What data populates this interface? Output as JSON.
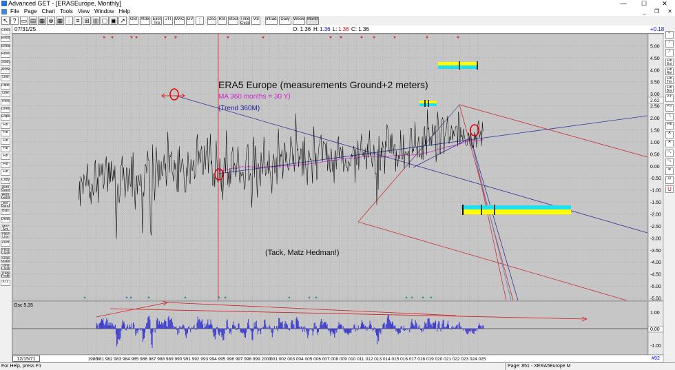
{
  "window": {
    "title": "Advanced GET - [ERASEurope, Monthly]",
    "min": "—",
    "max": "☐",
    "close": "✕"
  },
  "menu": {
    "items": [
      "File",
      "Page",
      "Chart",
      "Tools",
      "View",
      "Window",
      "Help"
    ],
    "mdi": [
      "_",
      "❐",
      "✕"
    ]
  },
  "toolbar": {
    "buttons": [
      "OSI",
      "Xtdes",
      "Eliot Trg",
      "JTI",
      "MACD",
      "GV",
      "Osc",
      "RSI",
      "Stoch",
      "Time Cycle",
      "Vol"
    ],
    "periods": [
      "Intraday",
      "Daily",
      "Weekly",
      "Monthly"
    ],
    "selected_period": "Monthly"
  },
  "header": {
    "date": "07/31/25",
    "o": "O: 1.36",
    "h_label": "H:",
    "h_value": "1.36",
    "l_label": "L:",
    "l_value": "1.36",
    "c": "C: 1.36",
    "change": "+0.18"
  },
  "left_tools": [
    "Cross",
    "Elliott",
    "Elliott",
    "Reset",
    "Study",
    "Arrow",
    "Line",
    "Pattern",
    "Line",
    "Trend",
    "Lines",
    "Ellipse",
    "Fib",
    "Fib",
    "Fib",
    "Fib",
    "Fib",
    "Fib",
    "Fib",
    "Copy",
    "Auto Gann",
    "Auto Gann",
    "Bol Band",
    "Bias",
    "Delta",
    "Mov Ave",
    "Pitch Line",
    "Pivot",
    "Price Cluster",
    "Seas onals",
    "Time Cluster",
    "Trade Profile",
    "XTL"
  ],
  "right_tools": [
    "↖",
    "⌇",
    "╱",
    "Fib Ext",
    "Fib Ret",
    "Fib Tim",
    "Fib Box",
    "XY",
    "PTI",
    "╲",
    "Fib",
    "A",
    "A",
    "🔍",
    "🔍",
    "⊕",
    "⊟",
    "U"
  ],
  "chart_data": [
    {
      "type": "line",
      "title": "ERA5 Europe (measurements Ground+2 meters)",
      "annotations": [
        "MA 360 months = 30 Y)",
        "(Trend 360M)",
        "(Tack, Matz Hedman!)"
      ],
      "price_label": "2.62",
      "ylim": [
        -5.6,
        5.5
      ],
      "y_ticks": [
        5.0,
        4.5,
        4.0,
        3.5,
        3.0,
        2.5,
        2.0,
        1.5,
        1.0,
        0.5,
        0.0,
        -0.5,
        -1.0,
        -1.5,
        -2.0,
        -2.5,
        -3.0,
        -3.5,
        -4.0,
        -4.5,
        -5.0,
        -5.5
      ],
      "x_labels": [
        "1980",
        "981",
        "982",
        "983",
        "984",
        "985",
        "986",
        "987",
        "988",
        "989",
        "990",
        "991",
        "992",
        "993",
        "994",
        "995",
        "996",
        "997",
        "998",
        "999",
        "2000",
        "001",
        "002",
        "003",
        "004",
        "005",
        "006",
        "007",
        "008",
        "009",
        "010",
        "011",
        "012",
        "013",
        "014",
        "015",
        "016",
        "017",
        "018",
        "019",
        "020",
        "021",
        "022",
        "023",
        "024",
        "025"
      ],
      "series": [
        {
          "x_start": 1979.0,
          "monthly_profile": [
            -1.4,
            -0.7,
            -1.2,
            0.0,
            -0.6,
            -0.8,
            -0.6,
            -0.9,
            -0.6,
            -0.5,
            -0.6,
            -0.7,
            0.2,
            -0.6,
            -0.5,
            -1.4,
            -1.2,
            -1.1,
            -0.5,
            -1.2,
            -0.3,
            -0.6,
            -0.3,
            -0.5,
            -0.9,
            -0.9,
            -1.6,
            0.4,
            -0.5,
            -0.6,
            0.4,
            0.1,
            -0.5,
            -0.9,
            -0.4,
            -0.3,
            0.3,
            0.9,
            -0.8,
            -0.9,
            0.6,
            -0.4,
            -0.4,
            -0.3,
            -0.3,
            -0.3,
            -0.3,
            -0.3,
            -0.5,
            -0.2,
            -3.8,
            -1.4,
            -0.4,
            -1.0,
            -0.6,
            -1.5,
            -0.3,
            -0.2,
            0.0,
            -0.6,
            0.2,
            -0.6,
            -1.2,
            -1.5,
            0.0,
            0.0,
            -0.8,
            -0.1,
            -0.4,
            -0.3,
            -0.6,
            0.1,
            -2.0,
            0.3,
            -1.4,
            -1.6,
            -2.3,
            -0.4,
            -0.5,
            -0.6,
            0.1,
            -0.6,
            -0.3,
            -1.0,
            -0.2,
            -2.6,
            -2.4,
            -0.8,
            -0.4,
            0.0,
            -0.1,
            0.4,
            -0.2,
            0.5,
            -0.3,
            0.0,
            -2.6,
            -2.3,
            -3.1,
            0.4,
            0.1,
            -0.2,
            -1.0,
            -0.6,
            0.6,
            0.0,
            -0.8,
            -0.5,
            -0.1,
            -0.2,
            0.3,
            0.9,
            0.0,
            -0.7,
            -0.1,
            0.1,
            0.4,
            -0.1,
            -0.4,
            0.2,
            2.8,
            -0.7,
            0.7,
            0.9,
            0.2,
            0.3,
            0.1,
            0.0,
            0.0,
            0.4,
            0.3,
            0.0,
            -1.3,
            0.9,
            -0.5,
            0.5,
            -0.1,
            -0.6,
            0.3,
            -0.3,
            -0.1,
            -0.3,
            -0.6,
            -1.0,
            -0.4,
            -0.6,
            0.4,
            1.5,
            -0.1,
            -0.5,
            0.1,
            0.2,
            -0.2,
            0.1,
            -0.1,
            -0.5,
            -0.7,
            0.3,
            0.0,
            1.6,
            0.0,
            0.1,
            0.1,
            0.2,
            0.0,
            0.4,
            -0.1,
            -0.4,
            -0.1,
            0.5,
            -0.7,
            0.5,
            0.0,
            1.1,
            -1.0,
            0.7,
            1.2,
            0.6,
            -0.2,
            0.1,
            -1.0,
            -1.2,
            -0.4,
            -1.2,
            1.4,
            -0.1,
            0.0,
            -0.2,
            -0.6,
            -0.4,
            -0.2,
            -0.9,
            -0.1,
            -1.2,
            -0.5,
            0.1,
            0.7,
            0.2,
            0.9,
            0.8,
            -0.2,
            -0.1,
            -0.5,
            -0.3,
            -0.4,
            0.2,
            0.9,
            0.2,
            -0.5,
            0.4,
            -0.6,
            0.1,
            0.0,
            0.5,
            0.2,
            0.3,
            -0.1,
            -0.4,
            -0.1,
            -0.1,
            -0.4,
            -0.1,
            -0.6,
            -0.1,
            -0.5,
            0.4,
            0.9,
            0.5,
            0.1,
            -0.6,
            0.1,
            -0.1,
            -1.2,
            -0.7,
            0.3,
            0.8,
            0.1,
            0.8,
            0.8,
            -0.6,
            -1.0,
            -0.1,
            0.0,
            -0.2,
            -1.2,
            0.4,
            -0.7,
            0.0,
            -0.6,
            1.5,
            0.2,
            0.1,
            0.0,
            0.6,
            -0.7,
            -0.2,
            0.3,
            0.0,
            -0.4,
            -0.6,
            -0.9,
            0.4,
            0.2,
            -0.8,
            0.1,
            0.4,
            -0.4,
            0.3,
            1.0,
            0.5,
            0.1,
            0.7,
            0.3,
            0.6,
            -0.1,
            0.1,
            0.6,
            0.6,
            0.0,
            0.7,
            -0.2,
            0.2,
            0.4,
            0.5,
            0.5,
            0.8,
            0.6,
            -0.1,
            0.4,
            -0.4,
            0.1,
            1.5,
            1.9,
            0.8,
            1.3,
            0.5,
            0.6,
            0.6,
            0.0,
            0.5,
            -0.9,
            1.1,
            0.1,
            1.3,
            0.8,
            -0.1,
            0.1,
            -0.5,
            0.3,
            0.6,
            0.9,
            0.0,
            0.1,
            0.1,
            -0.3,
            1.8,
            1.6,
            0.4,
            0.8,
            0.1,
            -0.2,
            0.4,
            0.9,
            0.9,
            0.5,
            0.6,
            1.1,
            0.9,
            0.7,
            0.3,
            0.4,
            0.7,
            0.1,
            0.5,
            0.4,
            0.5,
            0.3,
            0.5,
            -0.5,
            0.9,
            0.5,
            -0.9,
            0.2,
            -0.3,
            0.3,
            0.4,
            0.5,
            1.0,
            1.6,
            1.4,
            0.7,
            1.1,
            0.6,
            0.4,
            -0.2,
            0.6,
            0.0,
            0.3,
            0.9,
            0.6,
            0.1,
            0.3,
            0.2,
            0.9,
            0.0,
            0.4,
            0.0,
            0.4,
            0.5,
            0.3,
            0.5,
            -0.6,
            0.4,
            0.1,
            0.4,
            0.7,
            0.1,
            0.3,
            0.7,
            1.1,
            0.8,
            1.1,
            0.2,
            0.9,
            0.5,
            0.3,
            0.0,
            0.4,
            0.8,
            0.9,
            1.1,
            1.2,
            0.8,
            0.4,
            0.6,
            0.6,
            0.5,
            0.8,
            0.3,
            0.3,
            -2.2,
            0.9,
            -0.6,
            1.0,
            0.0,
            -0.5,
            0.4,
            0.9,
            0.4,
            0.4,
            0.2,
            0.0,
            1.5,
            0.8,
            1.3,
            1.4,
            0.7,
            0.7,
            0.7,
            1.0,
            0.9,
            1.0,
            0.4,
            0.3,
            1.8,
            -0.4,
            1.1,
            0.2,
            0.6,
            0.3,
            0.6,
            0.9,
            1.0,
            0.5,
            0.6,
            0.6,
            0.8,
            0.2,
            0.2,
            0.4,
            0.7,
            0.0,
            1.1,
            1.1,
            0.5,
            1.0,
            1.1,
            1.4,
            1.1,
            1.4,
            0.9,
            1.4,
            1.1,
            1.6,
            1.3,
            0.3,
            1.3,
            0.9,
            0.8,
            0.8,
            0.2,
            1.6,
            0.7,
            1.1,
            1.8,
            0.5,
            0.8,
            0.3,
            2.0,
            1.3,
            1.3,
            1.5,
            1.4,
            1.5,
            0.8,
            1.4,
            1.3,
            0.9,
            1.0,
            1.2,
            0.4,
            1.0,
            2.3,
            2.1,
            0.7,
            0.7,
            0.6,
            2.6,
            1.9,
            1.2,
            1.3,
            1.0,
            1.8,
            1.4,
            0.6,
            1.9,
            1.5,
            1.2,
            1.0,
            0.9,
            1.2,
            1.5,
            1.4,
            1.1,
            0.9,
            0.9,
            1.3,
            1.4,
            1.5,
            1.4,
            1.9,
            1.3,
            1.4,
            1.7,
            1.2,
            1.5,
            1.5,
            1.8,
            1.5,
            1.4,
            1.3,
            1.3,
            1.3,
            1.4,
            1.4,
            1.4,
            1.3,
            1.3,
            1.3,
            1.3,
            1.3,
            1.3,
            1.3,
            1.3,
            1.3,
            1.3,
            1.3,
            1.3,
            1.3,
            1.3,
            1.3,
            1.3,
            1.3,
            1.4
          ]
        }
      ]
    },
    {
      "type": "bar",
      "title": "Osc 5,35",
      "y_ticks": [
        1.0,
        0.0,
        -1.0
      ],
      "label_value": "0.00"
    }
  ],
  "status": {
    "left": "For Help, press F1",
    "right": "Page: 851 - XERA5Europe M",
    "start_date": "12/15/71",
    "page_num": "#92"
  }
}
